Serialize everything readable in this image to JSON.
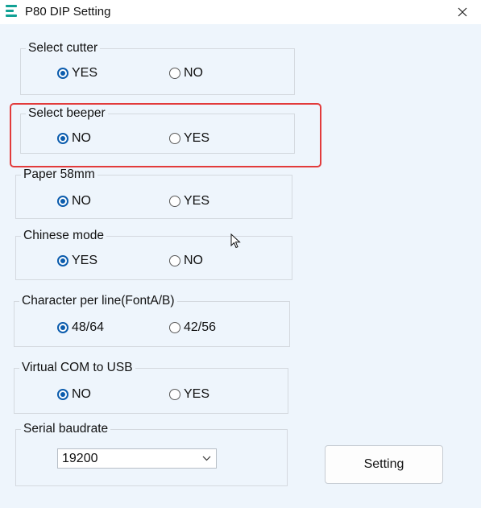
{
  "window": {
    "title": "P80 DIP Setting"
  },
  "groups": {
    "select_cutter": {
      "legend": "Select cutter",
      "options": [
        "YES",
        "NO"
      ],
      "selected": "YES"
    },
    "select_beeper": {
      "legend": "Select beeper",
      "options": [
        "NO",
        "YES"
      ],
      "selected": "NO"
    },
    "paper_58mm": {
      "legend": "Paper 58mm",
      "options": [
        "NO",
        "YES"
      ],
      "selected": "NO"
    },
    "chinese_mode": {
      "legend": "Chinese mode",
      "options": [
        "YES",
        "NO"
      ],
      "selected": "YES"
    },
    "char_per_line": {
      "legend": "Character per line(FontA/B)",
      "options": [
        "48/64",
        "42/56"
      ],
      "selected": "48/64"
    },
    "virtual_com": {
      "legend": "Virtual COM to USB",
      "options": [
        "NO",
        "YES"
      ],
      "selected": "NO"
    },
    "serial_baudrate": {
      "legend": "Serial baudrate",
      "value": "19200"
    }
  },
  "buttons": {
    "setting": "Setting"
  },
  "icons": {
    "close": "close-icon",
    "dropdown": "chevron-down-icon",
    "app": "app-icon",
    "cursor": "mouse-cursor-icon"
  },
  "colors": {
    "accent": "#0b5cad",
    "highlight": "#e23b3b",
    "app_icon": "#12a195"
  }
}
